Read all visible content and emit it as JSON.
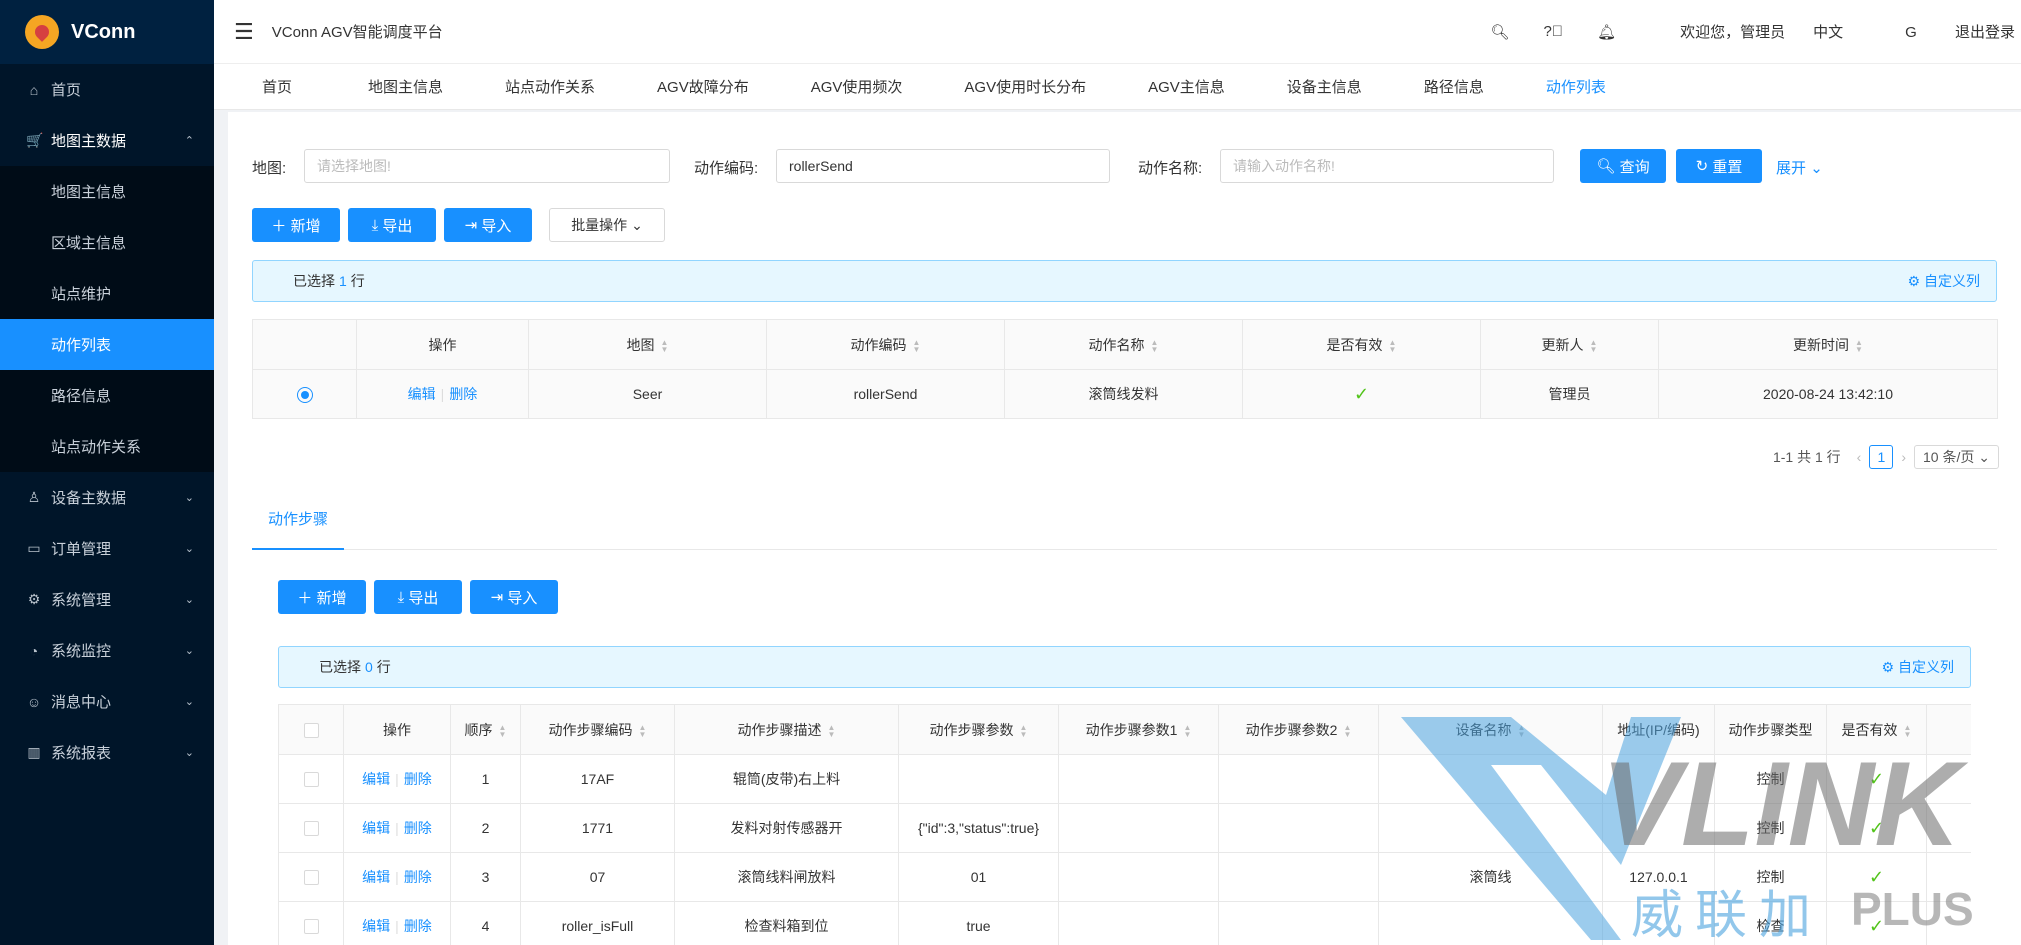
{
  "app": {
    "brand": "VConn",
    "title": "VConn AGV智能调度平台"
  },
  "header": {
    "welcome": "欢迎您，管理员",
    "lang": "中文",
    "logout": "退出登录"
  },
  "sidebar": {
    "items": [
      {
        "label": "首页"
      },
      {
        "label": "地图主数据"
      },
      {
        "label": "设备主数据"
      },
      {
        "label": "订单管理"
      },
      {
        "label": "系统管理"
      },
      {
        "label": "系统监控"
      },
      {
        "label": "消息中心"
      },
      {
        "label": "系统报表"
      }
    ],
    "sub": [
      "地图主信息",
      "区域主信息",
      "站点维护",
      "动作列表",
      "路径信息",
      "站点动作关系"
    ]
  },
  "tabs": [
    "首页",
    "地图主信息",
    "站点动作关系",
    "AGV故障分布",
    "AGV使用频次",
    "AGV使用时长分布",
    "AGV主信息",
    "设备主信息",
    "路径信息",
    "动作列表"
  ],
  "search": {
    "map_label": "地图:",
    "map_placeholder": "请选择地图!",
    "code_label": "动作编码:",
    "code_value": "rollerSend",
    "name_label": "动作名称:",
    "name_placeholder": "请输入动作名称!",
    "query": "查询",
    "reset": "重置",
    "expand": "展开"
  },
  "toolbar": {
    "add": "新增",
    "export": "导出",
    "import": "导入",
    "batch": "批量操作"
  },
  "selected1": {
    "prefix": "已选择",
    "count": "1",
    "suffix": "行",
    "custom": "自定义列"
  },
  "table1": {
    "headers": [
      "操作",
      "地图",
      "动作编码",
      "动作名称",
      "是否有效",
      "更新人",
      "更新时间"
    ],
    "row": {
      "edit": "编辑",
      "del": "删除",
      "map": "Seer",
      "code": "rollerSend",
      "name": "滚筒线发料",
      "valid": "✓",
      "updater": "管理员",
      "time": "2020-08-24 13:42:10"
    }
  },
  "pagination": {
    "summary": "1-1 共 1 行",
    "page": "1",
    "size": "10 条/页"
  },
  "steps_tab": "动作步骤",
  "toolbar2": {
    "add": "新增",
    "export": "导出",
    "import": "导入"
  },
  "selected2": {
    "prefix": "已选择",
    "count": "0",
    "suffix": "行",
    "custom": "自定义列"
  },
  "table2": {
    "headers": [
      "操作",
      "顺序",
      "动作步骤编码",
      "动作步骤描述",
      "动作步骤参数",
      "动作步骤参数1",
      "动作步骤参数2",
      "设备名称",
      "地址(IP/编码)",
      "动作步骤类型",
      "是否有效",
      "更"
    ],
    "rows": [
      {
        "seq": "1",
        "code": "17AF",
        "desc": "辊筒(皮带)右上料",
        "param": "",
        "p1": "",
        "p2": "",
        "device": "",
        "addr": "",
        "type": "控制",
        "valid": "✓"
      },
      {
        "seq": "2",
        "code": "1771",
        "desc": "发料对射传感器开",
        "param": "{\"id\":3,\"status\":true}",
        "p1": "",
        "p2": "",
        "device": "",
        "addr": "",
        "type": "控制",
        "valid": "✓"
      },
      {
        "seq": "3",
        "code": "07",
        "desc": "滚筒线料闸放料",
        "param": "01",
        "p1": "",
        "p2": "",
        "device": "滚筒线",
        "addr": "127.0.0.1",
        "type": "控制",
        "valid": "✓"
      },
      {
        "seq": "4",
        "code": "roller_isFull",
        "desc": "检查料箱到位",
        "param": "true",
        "p1": "",
        "p2": "",
        "device": "",
        "addr": "",
        "type": "检查",
        "valid": "✓"
      }
    ],
    "edit": "编辑",
    "del": "删除"
  },
  "watermark": {
    "brand": "VLINK",
    "cn": "威联加",
    "plus": "PLUS"
  }
}
